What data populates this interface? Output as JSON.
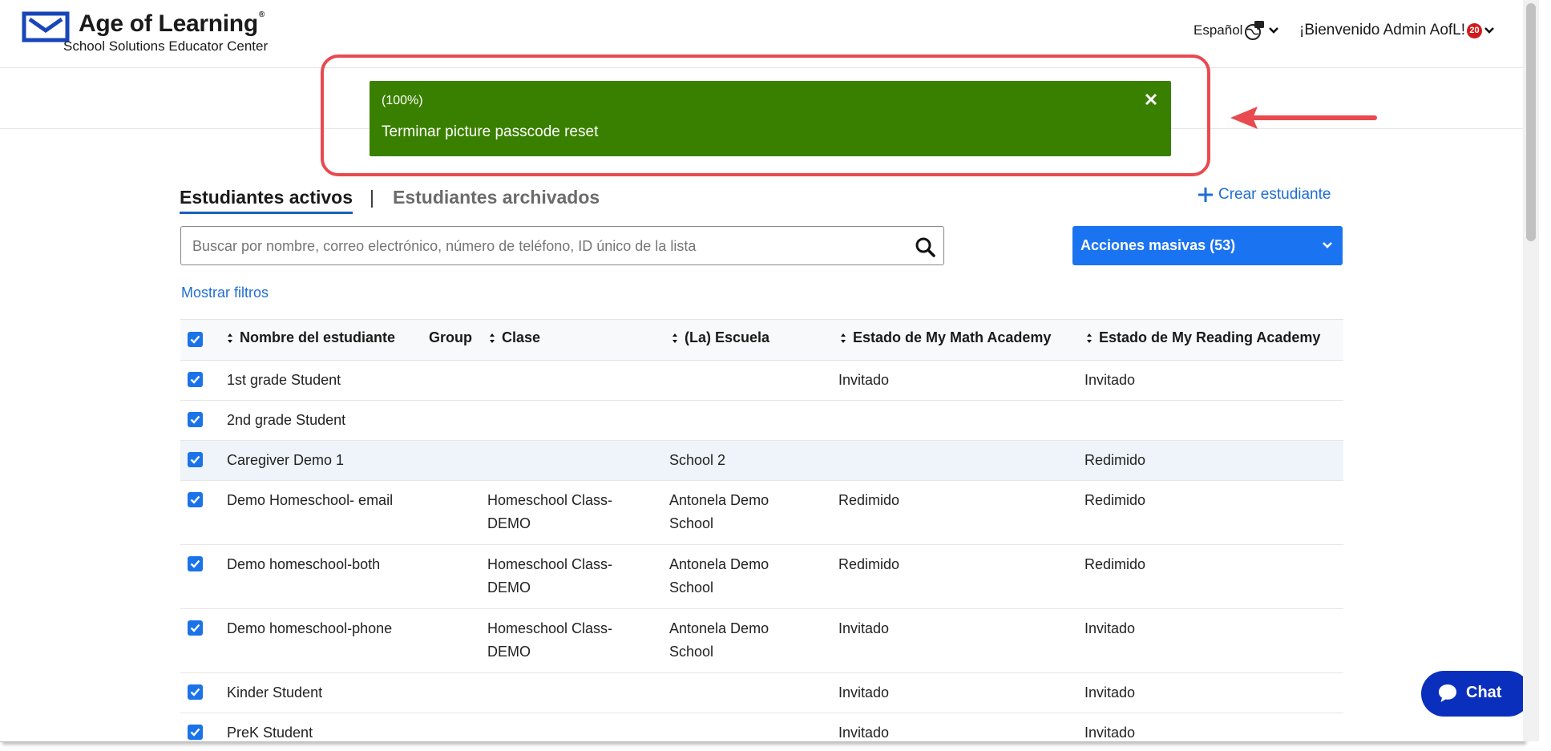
{
  "header": {
    "brand_title": "Age of Learning",
    "brand_tm": "®",
    "brand_subtitle": "School Solutions Educator Center",
    "language": "Español",
    "welcome": "¡Bienvenido Admin AofL!",
    "notification_count": "20"
  },
  "toast": {
    "progress": "(100%)",
    "message": "Terminar picture passcode reset",
    "color": "#3a8000",
    "highlight_color": "#e84a4f"
  },
  "tabs": {
    "active": "Estudiantes activos",
    "separator": "|",
    "archived": "Estudiantes archivados"
  },
  "actions": {
    "create_student": "Crear estudiante",
    "search_placeholder": "Buscar por nombre, correo electrónico, número de teléfono, ID único de la lista",
    "bulk_actions": "Acciones masivas (53)",
    "show_filters": "Mostrar filtros"
  },
  "table": {
    "headers": {
      "name": "Nombre del estudiante",
      "group": "Group",
      "class": "Clase",
      "school": "(La) Escuela",
      "math": "Estado de My Math Academy",
      "reading": "Estado de My Reading Academy"
    },
    "rows": [
      {
        "name": "1st grade Student",
        "class": [
          "",
          ""
        ],
        "school": [
          "",
          ""
        ],
        "math": "Invitado",
        "reading": "Invitado"
      },
      {
        "name": "2nd grade Student",
        "class": [
          "",
          ""
        ],
        "school": [
          "",
          ""
        ],
        "math": "",
        "reading": ""
      },
      {
        "name": "Caregiver Demo 1",
        "class": [
          "",
          ""
        ],
        "school": [
          "School 2",
          ""
        ],
        "math": "",
        "reading": "Redimido"
      },
      {
        "name": "Demo Homeschool- email",
        "class": [
          "Homeschool Class-",
          "DEMO"
        ],
        "school": [
          "Antonela Demo",
          "School"
        ],
        "math": "Redimido",
        "reading": "Redimido"
      },
      {
        "name": "Demo homeschool-both",
        "class": [
          "Homeschool Class-",
          "DEMO"
        ],
        "school": [
          "Antonela Demo",
          "School"
        ],
        "math": "Redimido",
        "reading": "Redimido"
      },
      {
        "name": "Demo homeschool-phone",
        "class": [
          "Homeschool Class-",
          "DEMO"
        ],
        "school": [
          "Antonela Demo",
          "School"
        ],
        "math": "Invitado",
        "reading": "Invitado"
      },
      {
        "name": "Kinder Student",
        "class": [
          "",
          ""
        ],
        "school": [
          "",
          ""
        ],
        "math": "Invitado",
        "reading": "Invitado"
      },
      {
        "name": "PreK Student",
        "class": [
          "",
          ""
        ],
        "school": [
          "",
          ""
        ],
        "math": "Invitado",
        "reading": "Invitado"
      }
    ]
  },
  "chat": {
    "label": "Chat"
  },
  "colors": {
    "primary": "#1a73f0",
    "link": "#1f6ed4",
    "chat": "#0b2fbd",
    "notification": "#d11a1a"
  }
}
